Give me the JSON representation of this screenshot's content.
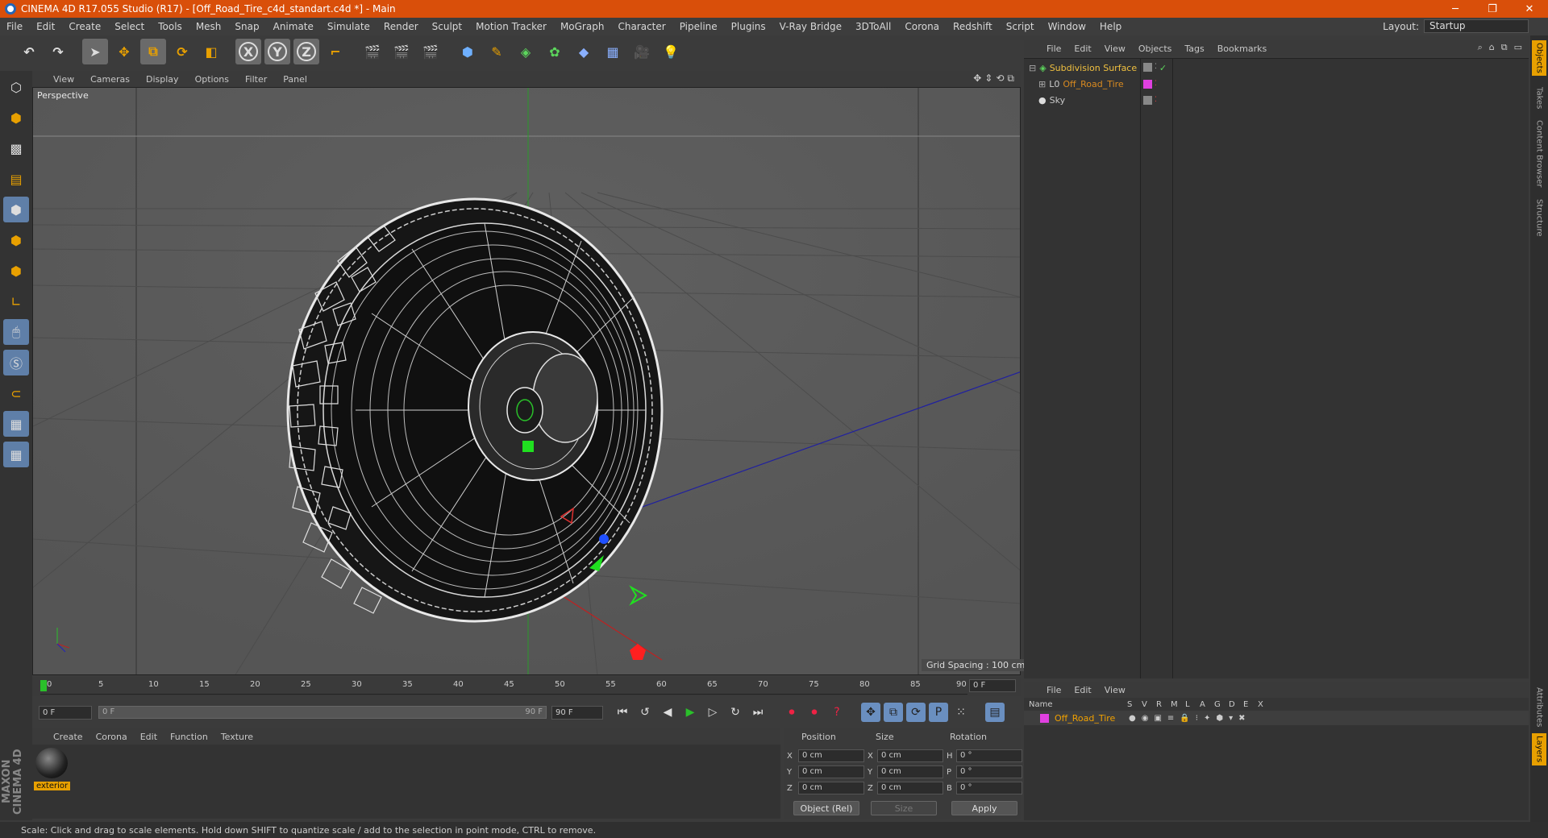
{
  "window": {
    "title": "CINEMA 4D R17.055 Studio (R17) - [Off_Road_Tire_c4d_standart.c4d *] - Main",
    "controls": [
      "─",
      "❐",
      "✕"
    ]
  },
  "menubar": {
    "items": [
      "File",
      "Edit",
      "Create",
      "Select",
      "Tools",
      "Mesh",
      "Snap",
      "Animate",
      "Simulate",
      "Render",
      "Sculpt",
      "Motion Tracker",
      "MoGraph",
      "Character",
      "Pipeline",
      "Plugins",
      "V-Ray Bridge",
      "3DToAll",
      "Corona",
      "Redshift",
      "Script",
      "Window",
      "Help"
    ],
    "layout_label": "Layout:",
    "layout_value": "Startup"
  },
  "toolbar": {
    "axis_x": "X",
    "axis_y": "Y",
    "axis_z": "Z"
  },
  "viewport": {
    "menu": [
      "View",
      "Cameras",
      "Display",
      "Options",
      "Filter",
      "Panel"
    ],
    "label": "Perspective",
    "grid_spacing": "Grid Spacing : 100 cm"
  },
  "timeline": {
    "ticks": [
      "0",
      "5",
      "10",
      "15",
      "20",
      "25",
      "30",
      "35",
      "40",
      "45",
      "50",
      "55",
      "60",
      "65",
      "70",
      "75",
      "80",
      "85",
      "90"
    ],
    "current_frame": "0 F",
    "start_field": "0 F",
    "slider_start": "0 F",
    "slider_end": "90 F",
    "end_field": "90 F"
  },
  "material": {
    "menu": [
      "Create",
      "Corona",
      "Edit",
      "Function",
      "Texture"
    ],
    "name": "exterior"
  },
  "coordinates": {
    "headers": [
      "Position",
      "Size",
      "Rotation"
    ],
    "rows": [
      {
        "a": "X",
        "pos": "0 cm",
        "b": "X",
        "size": "0 cm",
        "c": "H",
        "rot": "0 °"
      },
      {
        "a": "Y",
        "pos": "0 cm",
        "b": "Y",
        "size": "0 cm",
        "c": "P",
        "rot": "0 °"
      },
      {
        "a": "Z",
        "pos": "0 cm",
        "b": "Z",
        "size": "0 cm",
        "c": "B",
        "rot": "0 °"
      }
    ],
    "mode": "Object (Rel)",
    "size_mode": "Size",
    "apply": "Apply"
  },
  "objects": {
    "menu": [
      "File",
      "Edit",
      "View",
      "Objects",
      "Tags",
      "Bookmarks"
    ],
    "items": [
      {
        "name": "Subdivision Surface",
        "color": "#f0c040"
      },
      {
        "name": "Off_Road_Tire",
        "color": "#d88a20"
      },
      {
        "name": "Sky",
        "color": "#c8c8c8"
      }
    ]
  },
  "layers": {
    "menu": [
      "File",
      "Edit",
      "View"
    ],
    "columns": [
      "Name",
      "S",
      "V",
      "R",
      "M",
      "L",
      "A",
      "G",
      "D",
      "E",
      "X"
    ],
    "row_name": "Off_Road_Tire",
    "row_color": "#e040e0"
  },
  "sidetabs": [
    "Objects",
    "Takes",
    "Content Browser",
    "Structure",
    "Attributes",
    "Layers"
  ],
  "maxon": "MAXON CINEMA 4D",
  "status": "Scale: Click and drag to scale elements. Hold down SHIFT to quantize scale / add to the selection in point mode, CTRL to remove."
}
